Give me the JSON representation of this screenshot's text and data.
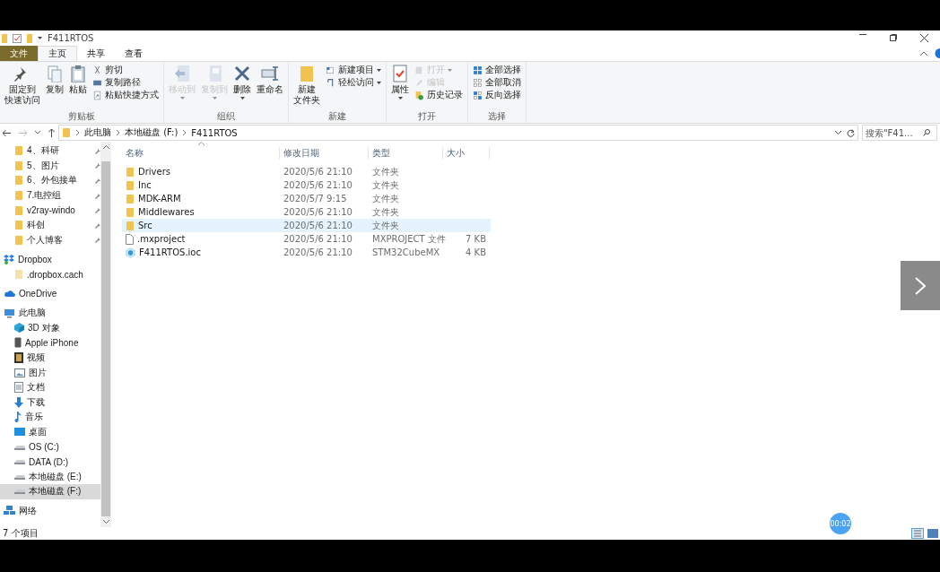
{
  "window": {
    "title": "F411RTOS"
  },
  "ribbon_tabs": [
    {
      "label": "文件",
      "selected": false,
      "kind": "file"
    },
    {
      "label": "主页",
      "selected": true,
      "kind": "tab"
    },
    {
      "label": "共享",
      "selected": false,
      "kind": "tab"
    },
    {
      "label": "查看",
      "selected": false,
      "kind": "tab"
    }
  ],
  "ribbon_groups": [
    {
      "label": "剪贴板",
      "items": [
        {
          "label_lines": [
            "固定到",
            "快速访问"
          ],
          "kind": "large",
          "disabled": false,
          "dropdown": false
        },
        {
          "label": "复制",
          "kind": "large",
          "disabled": false,
          "dropdown": false
        },
        {
          "label": "粘贴",
          "kind": "large",
          "disabled": false,
          "dropdown": false
        },
        {
          "label": "剪切",
          "kind": "small",
          "disabled": false,
          "dropdown": false
        },
        {
          "label": "复制路径",
          "kind": "small",
          "disabled": false,
          "dropdown": false
        },
        {
          "label": "粘贴快捷方式",
          "kind": "small",
          "disabled": false,
          "dropdown": false
        }
      ]
    },
    {
      "label": "组织",
      "items": [
        {
          "label": "移动到",
          "kind": "large",
          "disabled": true,
          "dropdown": true
        },
        {
          "label": "复制到",
          "kind": "large",
          "disabled": true,
          "dropdown": true
        },
        {
          "label": "删除",
          "kind": "large",
          "disabled": false,
          "dropdown": true
        },
        {
          "label": "重命名",
          "kind": "large",
          "disabled": false,
          "dropdown": false
        }
      ]
    },
    {
      "label": "新建",
      "items": [
        {
          "label_lines": [
            "新建",
            "文件夹"
          ],
          "kind": "large",
          "disabled": false,
          "dropdown": false
        },
        {
          "label": "新建项目",
          "kind": "small",
          "disabled": false,
          "dropdown": true
        },
        {
          "label": "轻松访问",
          "kind": "small",
          "disabled": false,
          "dropdown": true
        }
      ]
    },
    {
      "label": "打开",
      "items": [
        {
          "label": "属性",
          "kind": "large",
          "disabled": false,
          "dropdown": true
        },
        {
          "label": "打开",
          "kind": "small",
          "disabled": true,
          "dropdown": true
        },
        {
          "label": "编辑",
          "kind": "small",
          "disabled": true,
          "dropdown": false
        },
        {
          "label": "历史记录",
          "kind": "small",
          "disabled": false,
          "dropdown": false
        }
      ]
    },
    {
      "label": "选择",
      "items": [
        {
          "label": "全部选择",
          "kind": "small",
          "disabled": false,
          "dropdown": false
        },
        {
          "label": "全部取消",
          "kind": "small",
          "disabled": false,
          "dropdown": false
        },
        {
          "label": "反向选择",
          "kind": "small",
          "disabled": false,
          "dropdown": false
        }
      ]
    }
  ],
  "address_bar": {
    "crumbs": [
      "此电脑",
      "本地磁盘 (F:)",
      "F411RTOS"
    ]
  },
  "search": {
    "placeholder": "搜索\"F41..."
  },
  "sidebar": {
    "items": [
      {
        "label": "4、科研",
        "kind": "folder",
        "pinned": true,
        "selected": false
      },
      {
        "label": "5、图片",
        "kind": "folder",
        "pinned": true,
        "selected": false
      },
      {
        "label": "6、外包接单",
        "kind": "folder",
        "pinned": true,
        "selected": false
      },
      {
        "label": "7.电控组",
        "kind": "folder",
        "pinned": true,
        "selected": false
      },
      {
        "label": "v2ray-windo",
        "kind": "folder",
        "pinned": true,
        "selected": false
      },
      {
        "label": "科创",
        "kind": "folder",
        "pinned": true,
        "selected": false
      },
      {
        "label": "个人博客",
        "kind": "folder",
        "pinned": true,
        "selected": false
      },
      {
        "label": "Dropbox",
        "kind": "dropbox",
        "pinned": false,
        "selected": false,
        "children": [
          {
            "label": ".dropbox.cach",
            "kind": "folder-pale",
            "pinned": false,
            "selected": false
          }
        ]
      },
      {
        "label": "OneDrive",
        "kind": "cloud",
        "pinned": false,
        "selected": false
      },
      {
        "label": "此电脑",
        "kind": "pc",
        "pinned": false,
        "selected": false,
        "children": [
          {
            "label": "3D 对象",
            "kind": "cube",
            "pinned": false,
            "selected": false
          },
          {
            "label": "Apple iPhone",
            "kind": "phone",
            "pinned": false,
            "selected": false
          },
          {
            "label": "视频",
            "kind": "video",
            "pinned": false,
            "selected": false
          },
          {
            "label": "图片",
            "kind": "picture",
            "pinned": false,
            "selected": false
          },
          {
            "label": "文档",
            "kind": "document",
            "pinned": false,
            "selected": false
          },
          {
            "label": "下载",
            "kind": "download",
            "pinned": false,
            "selected": false
          },
          {
            "label": "音乐",
            "kind": "music",
            "pinned": false,
            "selected": false
          },
          {
            "label": "桌面",
            "kind": "desktop",
            "pinned": false,
            "selected": false
          },
          {
            "label": "OS (C:)",
            "kind": "drive",
            "pinned": false,
            "selected": false
          },
          {
            "label": "DATA (D:)",
            "kind": "drive",
            "pinned": false,
            "selected": false
          },
          {
            "label": "本地磁盘 (E:)",
            "kind": "drive",
            "pinned": false,
            "selected": false
          },
          {
            "label": "本地磁盘 (F:)",
            "kind": "drive",
            "pinned": false,
            "selected": true
          }
        ]
      },
      {
        "label": "网络",
        "kind": "network",
        "pinned": false,
        "selected": false
      }
    ]
  },
  "table": {
    "columns": [
      "名称",
      "修改日期",
      "类型",
      "大小"
    ],
    "rows": [
      {
        "name": "Drivers",
        "date": "2020/5/6 21:10",
        "type": "文件夹",
        "kind": "folder",
        "hovered": false
      },
      {
        "name": "Inc",
        "date": "2020/5/6 21:10",
        "type": "文件夹",
        "kind": "folder",
        "hovered": false
      },
      {
        "name": "MDK-ARM",
        "date": "2020/5/7 9:15",
        "type": "文件夹",
        "kind": "folder",
        "hovered": false
      },
      {
        "name": "Middlewares",
        "date": "2020/5/6 21:10",
        "type": "文件夹",
        "kind": "folder",
        "hovered": false
      },
      {
        "name": "Src",
        "date": "2020/5/6 21:10",
        "type": "文件夹",
        "kind": "folder",
        "hovered": true
      },
      {
        "name": ".mxproject",
        "date": "2020/5/6 21:10",
        "type": "MXPROJECT 文件",
        "size": "7 KB",
        "kind": "file",
        "hovered": false
      },
      {
        "name": "F411RTOS.ioc",
        "date": "2020/5/6 21:10",
        "type": "STM32CubeMX",
        "size": "4 KB",
        "kind": "ioc",
        "hovered": false
      }
    ]
  },
  "status_bar": {
    "count": "7 个项目"
  },
  "player": {
    "timer": "00:02"
  }
}
